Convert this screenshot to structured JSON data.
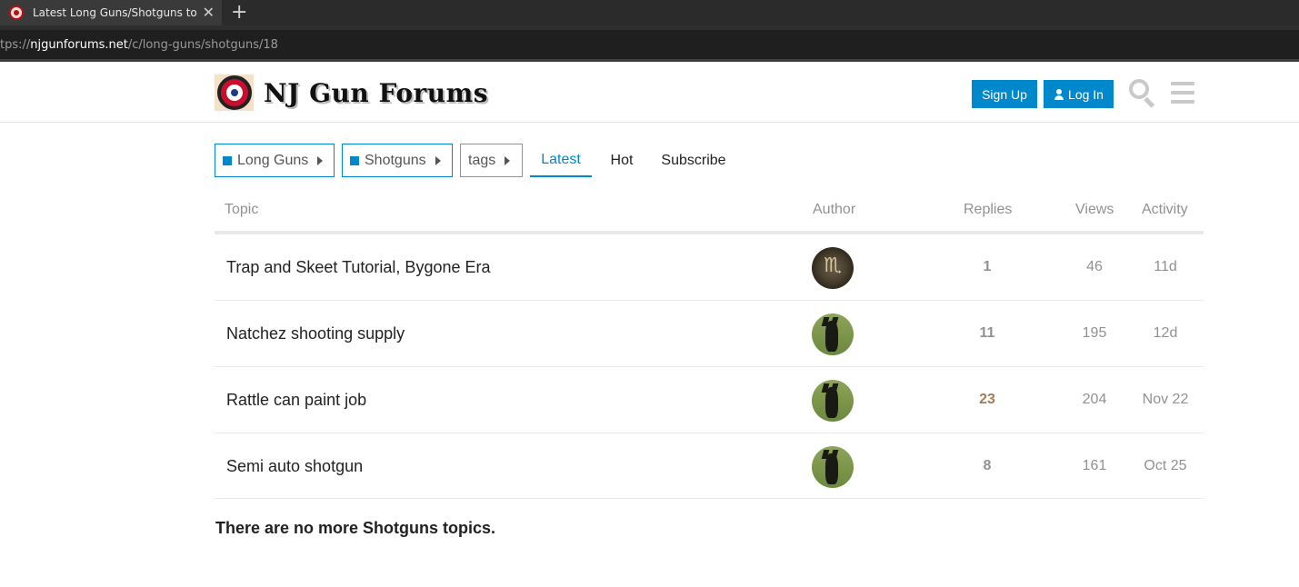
{
  "browser": {
    "tab_title": "Latest Long Guns/Shotguns topics",
    "tab_close": "✕",
    "new_tab": "+",
    "url_prefix": "tps://",
    "url_host": "njgunforums.net",
    "url_path": "/c/long-guns/shotguns/18"
  },
  "header": {
    "site_name": "NJ Gun Forums",
    "signup_label": "Sign Up",
    "login_label": "Log In"
  },
  "nav": {
    "category": "Long Guns",
    "subcategory": "Shotguns",
    "tags": "tags",
    "latest": "Latest",
    "hot": "Hot",
    "subscribe": "Subscribe"
  },
  "table": {
    "columns": {
      "topic": "Topic",
      "author": "Author",
      "replies": "Replies",
      "views": "Views",
      "activity": "Activity"
    },
    "rows": [
      {
        "title": "Trap and Skeet Tutorial, Bygone Era",
        "avatar": "scorpio-avatar",
        "replies": "1",
        "views": "46",
        "activity": "11d"
      },
      {
        "title": "Natchez shooting supply",
        "avatar": "dog-avatar",
        "replies": "11",
        "views": "195",
        "activity": "12d"
      },
      {
        "title": "Rattle can paint job",
        "avatar": "dog-avatar",
        "replies": "23",
        "views": "204",
        "activity": "Nov 22"
      },
      {
        "title": "Semi auto shotgun",
        "avatar": "dog-avatar",
        "replies": "8",
        "views": "161",
        "activity": "Oct 25"
      }
    ]
  },
  "footer_message": "There are no more Shotguns topics.",
  "colors": {
    "accent": "#0088cc",
    "hot_replies": "#a67c52",
    "muted": "#919191"
  }
}
